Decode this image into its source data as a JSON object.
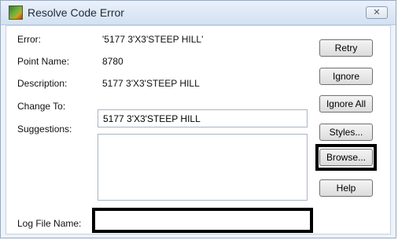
{
  "window": {
    "title": "Resolve Code Error",
    "close_glyph": "✕"
  },
  "form": {
    "error_label": "Error:",
    "error_value": "'5177 3'X3'STEEP HILL'",
    "point_name_label": "Point Name:",
    "point_name_value": "8780",
    "description_label": "Description:",
    "description_value": "5177 3'X3'STEEP HILL",
    "change_to_label": "Change To:",
    "change_to_value": "5177 3'X3'STEEP HILL",
    "suggestions_label": "Suggestions:",
    "suggestions_items": [],
    "log_file_label": "Log File Name:",
    "log_file_value": ""
  },
  "buttons": {
    "retry": "Retry",
    "ignore": "Ignore",
    "ignore_all": "Ignore All",
    "styles": "Styles...",
    "browse": "Browse...",
    "help": "Help"
  },
  "icons": {
    "app": "survey-app-icon",
    "close": "close-icon"
  }
}
